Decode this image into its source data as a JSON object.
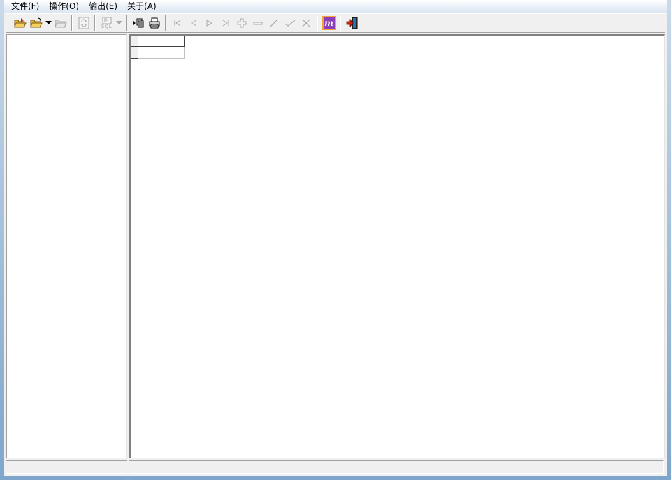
{
  "menu": {
    "file": "文件(F)",
    "operate": "操作(O)",
    "output": "输出(E)",
    "about": "关于(A)"
  },
  "toolbar": {
    "icons": [
      "open-red-folder-icon",
      "open-folder-icon",
      "dropdown-arrow-icon",
      "open-folder-disabled-icon",
      "refresh-icon",
      "sql-icon",
      "sql-dropdown-icon",
      "export-copy-icon",
      "print-icon",
      "first-record-icon",
      "prev-record-icon",
      "next-record-icon",
      "last-record-icon",
      "insert-record-icon",
      "delete-record-icon",
      "edit-record-icon",
      "post-record-icon",
      "cancel-record-icon",
      "app-logo-icon",
      "exit-icon"
    ],
    "sql_label": "SQL",
    "logo_label": "m"
  },
  "colors": {
    "accent_red": "#cc2200",
    "folder_yellow": "#e8b43a",
    "logo_purple": "#8a3fb8",
    "logo_orange": "#f3a23a",
    "disabled_gray": "#a8a8a8"
  },
  "status": {
    "left": "",
    "right": ""
  }
}
